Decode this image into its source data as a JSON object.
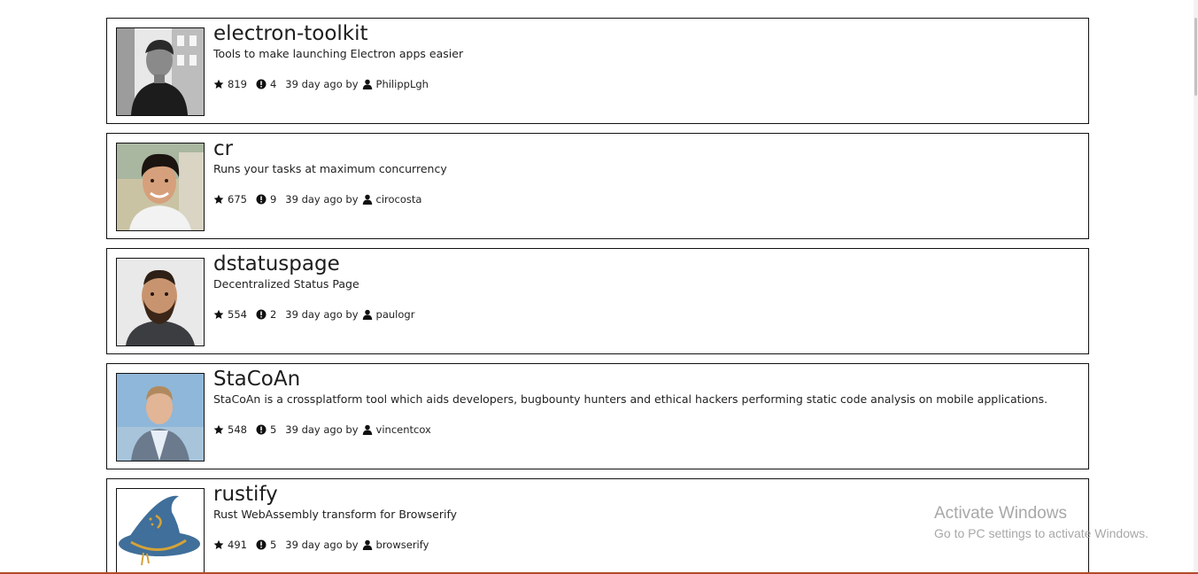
{
  "repos": [
    {
      "name": "electron-toolkit",
      "description": "Tools to make launching Electron apps easier",
      "stars": "819",
      "issues": "4",
      "updated": "39 day ago by",
      "author": "PhilippLgh",
      "avatar": "avatar-photo-bw"
    },
    {
      "name": "cr",
      "description": "Runs your tasks at maximum concurrency",
      "stars": "675",
      "issues": "9",
      "updated": "39 day ago by",
      "author": "cirocosta",
      "avatar": "avatar-photo"
    },
    {
      "name": "dstatuspage",
      "description": "Decentralized Status Page",
      "stars": "554",
      "issues": "2",
      "updated": "39 day ago by",
      "author": "paulogr",
      "avatar": "avatar-photo"
    },
    {
      "name": "StaCoAn",
      "description": "StaCoAn is a crossplatform tool which aids developers, bugbounty hunters and ethical hackers performing static code analysis on mobile applications.",
      "stars": "548",
      "issues": "5",
      "updated": "39 day ago by",
      "author": "vincentcox",
      "avatar": "avatar-photo"
    },
    {
      "name": "rustify",
      "description": "Rust WebAssembly transform for Browserify",
      "stars": "491",
      "issues": "5",
      "updated": "39 day ago by",
      "author": "browserify",
      "avatar": "wizard-hat-logo"
    }
  ],
  "watermark": {
    "title": "Activate Windows",
    "subtitle": "Go to PC settings to activate Windows."
  },
  "colors": {
    "border": "#111111",
    "text": "#1d1d1d",
    "wizard_hat": "#3f6f9a",
    "wizard_band": "#d4a23a",
    "taskbar": "#b24a2a"
  }
}
